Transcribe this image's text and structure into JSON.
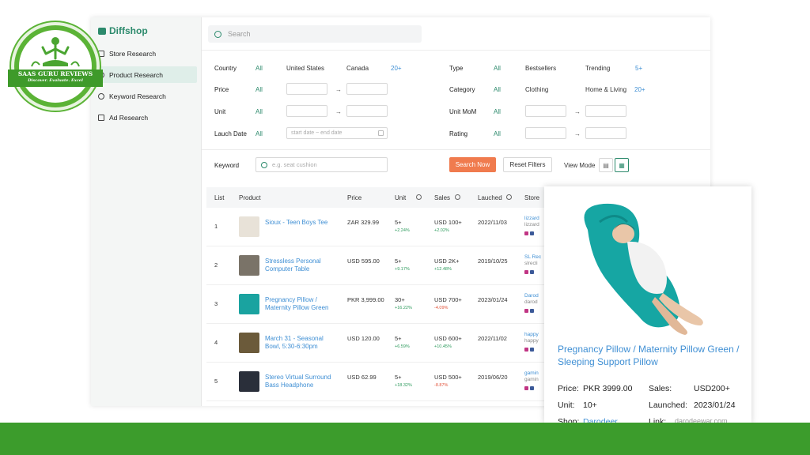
{
  "logo": {
    "line1": "SAAS GURU REVIEWS",
    "line2": "Discover. Evaluate. Excel"
  },
  "brand": {
    "name": "Diffshop"
  },
  "sidebar": {
    "items": [
      {
        "label": "Store Research",
        "icon": "store-icon"
      },
      {
        "label": "Product Research",
        "icon": "box-icon",
        "active": true
      },
      {
        "label": "Keyword Research",
        "icon": "key-icon"
      },
      {
        "label": "Ad Research",
        "icon": "facebook-icon"
      }
    ]
  },
  "search": {
    "placeholder": "Search"
  },
  "filters": {
    "country": {
      "label": "Country",
      "all": "All",
      "opt1": "United States",
      "opt2": "Canada",
      "more": "20+"
    },
    "type": {
      "label": "Type",
      "all": "All",
      "opt1": "Bestsellers",
      "opt2": "Trending",
      "more": "5+"
    },
    "price": {
      "label": "Price",
      "all": "All",
      "arrow": "→"
    },
    "category": {
      "label": "Category",
      "all": "All",
      "opt1": "Clothing",
      "opt2": "Home & Living",
      "more": "20+"
    },
    "unit": {
      "label": "Unit",
      "all": "All",
      "arrow": "→"
    },
    "unit_mom": {
      "label": "Unit MoM",
      "all": "All",
      "arrow": "→"
    },
    "launch_date": {
      "label": "Lauch Date",
      "all": "All",
      "placeholder": "start date ~ end date"
    },
    "rating": {
      "label": "Rating",
      "all": "All",
      "arrow": "→"
    },
    "keyword": {
      "label": "Keyword",
      "placeholder": "e.g. seat cushion"
    }
  },
  "actions": {
    "search_now": "Search Now",
    "reset": "Reset Filters",
    "view_mode": "View Mode"
  },
  "table": {
    "headers": {
      "list": "List",
      "product": "Product",
      "price": "Price",
      "unit": "Unit",
      "sales": "Sales",
      "launched": "Lauched",
      "store": "Store"
    },
    "rows": [
      {
        "n": "1",
        "name": "Sioux - Teen Boys Tee",
        "price": "ZAR 329.99",
        "unit": "5+",
        "unit_chg": "+2.24%",
        "unit_dir": "up",
        "sales": "USD 100+",
        "sales_chg": "+2.02%",
        "sales_dir": "up",
        "date": "2022/11/03",
        "store1": "lizzard",
        "store2": "lizzard",
        "thumb_color": "#e8e2d8"
      },
      {
        "n": "2",
        "name": "Stressless Personal Computer Table",
        "price": "USD 595.00",
        "unit": "5+",
        "unit_chg": "+9.17%",
        "unit_dir": "up",
        "sales": "USD 2K+",
        "sales_chg": "+12.48%",
        "sales_dir": "up",
        "date": "2019/10/25",
        "store1": "SL Rec",
        "store2": "slrecli",
        "thumb_color": "#7a7368"
      },
      {
        "n": "3",
        "name": "Pregnancy Pillow / Maternity Pillow Green",
        "price": "PKR 3,999.00",
        "unit": "30+",
        "unit_chg": "+16.22%",
        "unit_dir": "up",
        "sales": "USD 700+",
        "sales_chg": "-4.09%",
        "sales_dir": "down",
        "date": "2023/01/24",
        "store1": "Darod",
        "store2": "darod",
        "thumb_color": "#1aa3a0"
      },
      {
        "n": "4",
        "name": "March 31 - Seasonal Bowl, 5:30-6:30pm",
        "price": "USD 120.00",
        "unit": "5+",
        "unit_chg": "+6.59%",
        "unit_dir": "up",
        "sales": "USD 600+",
        "sales_chg": "+10.45%",
        "sales_dir": "up",
        "date": "2022/11/02",
        "store1": "happy",
        "store2": "happy",
        "thumb_color": "#6b5a3a"
      },
      {
        "n": "5",
        "name": "Stereo Virtual Surround Bass Headphone",
        "price": "USD 62.99",
        "unit": "5+",
        "unit_chg": "+18.32%",
        "unit_dir": "up",
        "sales": "USD 500+",
        "sales_chg": "-8.87%",
        "sales_dir": "down",
        "date": "2019/06/20",
        "store1": "gamin",
        "store2": "gamin",
        "thumb_color": "#2a2f3a"
      }
    ]
  },
  "popup": {
    "title": "Pregnancy Pillow / Maternity Pillow Green / Sleeping Support Pillow",
    "price_label": "Price:",
    "price": "PKR 3999.00",
    "sales_label": "Sales:",
    "sales": "USD200+",
    "unit_label": "Unit:",
    "unit": "10+",
    "launched_label": "Launched:",
    "launched": "2023/01/24",
    "shop_label": "Shop:",
    "shop": "Darodeer",
    "link_label": "Link:",
    "link": "darodeewar.com"
  },
  "colors": {
    "accent": "#2c8a6c",
    "link": "#3f8fd4",
    "search_button": "#f07b4e",
    "band": "#3c9c2c"
  }
}
